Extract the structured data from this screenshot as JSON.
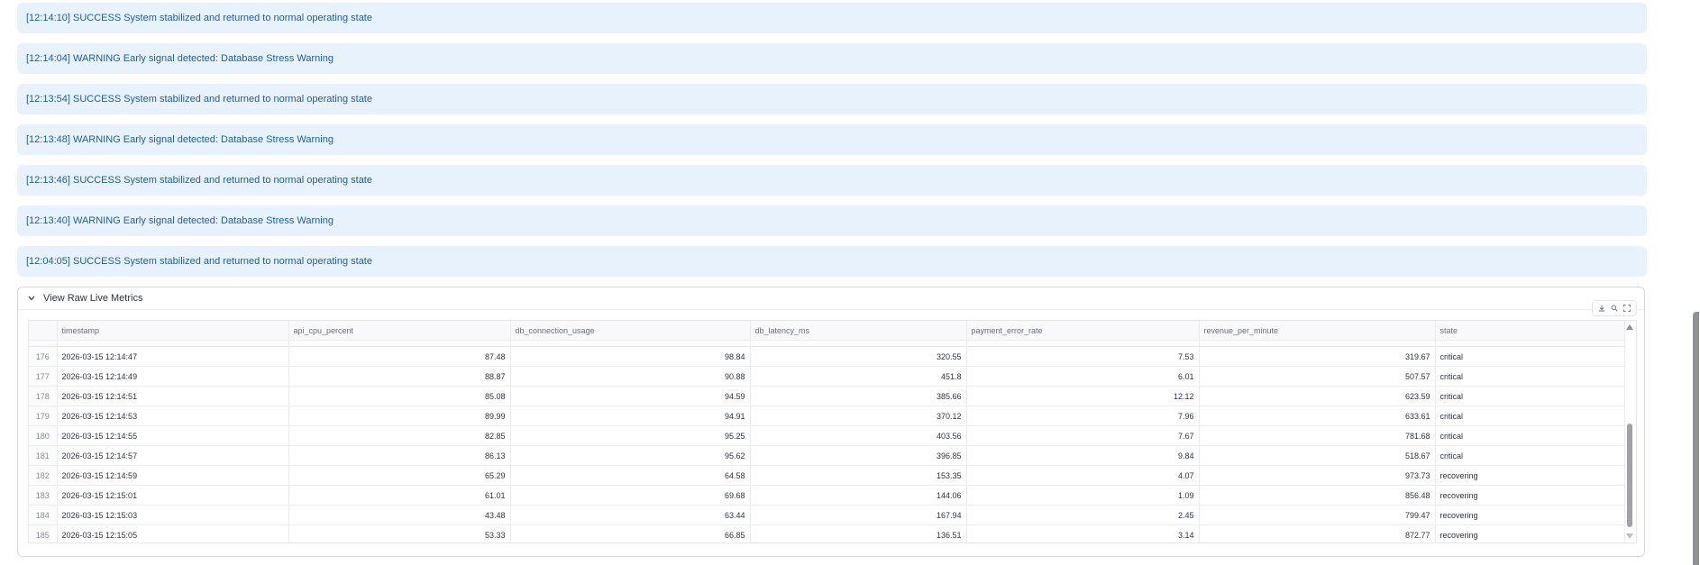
{
  "alerts": [
    "[12:14:10] SUCCESS System stabilized and returned to normal operating state",
    "[12:14:04] WARNING Early signal detected: Database Stress Warning",
    "[12:13:54] SUCCESS System stabilized and returned to normal operating state",
    "[12:13:48] WARNING Early signal detected: Database Stress Warning",
    "[12:13:46] SUCCESS System stabilized and returned to normal operating state",
    "[12:13:40] WARNING Early signal detected: Database Stress Warning",
    "[12:04:05] SUCCESS System stabilized and returned to normal operating state"
  ],
  "expander": {
    "label": "View Raw Live Metrics",
    "chevron_icon": "chevron-down-icon"
  },
  "toolbar": {
    "icons": [
      "download-icon",
      "search-icon",
      "fullscreen-icon"
    ]
  },
  "table": {
    "columns": [
      "",
      "timestamp",
      "api_cpu_percent",
      "db_connection_usage",
      "db_latency_ms",
      "payment_error_rate",
      "revenue_per_minute",
      "state"
    ],
    "rows": [
      [
        "176",
        "2026-03-15 12:14:47",
        "87.48",
        "98.84",
        "320.55",
        "7.53",
        "319.67",
        "critical"
      ],
      [
        "177",
        "2026-03-15 12:14:49",
        "88.87",
        "90.88",
        "451.8",
        "6.01",
        "507.57",
        "critical"
      ],
      [
        "178",
        "2026-03-15 12:14:51",
        "85.08",
        "94.59",
        "385.66",
        "12.12",
        "623.59",
        "critical"
      ],
      [
        "179",
        "2026-03-15 12:14:53",
        "89.99",
        "94.91",
        "370.12",
        "7.96",
        "633.61",
        "critical"
      ],
      [
        "180",
        "2026-03-15 12:14:55",
        "82.85",
        "95.25",
        "403.56",
        "7.67",
        "781.68",
        "critical"
      ],
      [
        "181",
        "2026-03-15 12:14:57",
        "86.13",
        "95.62",
        "396.85",
        "9.84",
        "518.67",
        "critical"
      ],
      [
        "182",
        "2026-03-15 12:14:59",
        "65.29",
        "64.58",
        "153.35",
        "4.07",
        "973.73",
        "recovering"
      ],
      [
        "183",
        "2026-03-15 12:15:01",
        "61.01",
        "69.68",
        "144.06",
        "1.09",
        "856.48",
        "recovering"
      ],
      [
        "184",
        "2026-03-15 12:15:03",
        "43.48",
        "63.44",
        "167.94",
        "2.45",
        "799.47",
        "recovering"
      ],
      [
        "185",
        "2026-03-15 12:15:05",
        "53.33",
        "66.85",
        "136.51",
        "3.14",
        "872.77",
        "recovering"
      ]
    ]
  },
  "colors": {
    "alert_bg": "#e8f2fc",
    "alert_text": "#1d5f98"
  }
}
